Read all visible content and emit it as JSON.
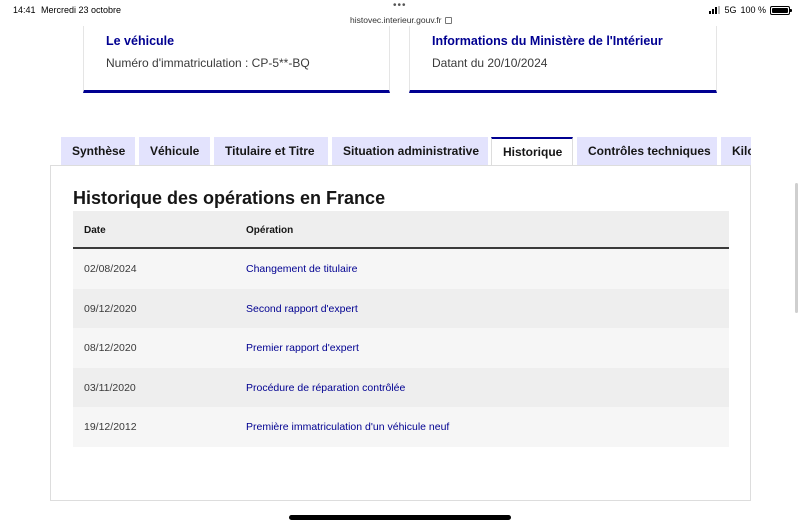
{
  "status_bar": {
    "time": "14:41",
    "date": "Mercredi 23 octobre",
    "url": "histovec.interieur.gouv.fr",
    "network": "5G",
    "battery": "100 %"
  },
  "cards": [
    {
      "title": "Le véhicule",
      "subtitle": "Numéro d'immatriculation : CP-5**-BQ"
    },
    {
      "title": "Informations du Ministère de l'Intérieur",
      "subtitle": "Datant du 20/10/2024"
    }
  ],
  "tabs": [
    {
      "label": "Synthèse"
    },
    {
      "label": "Véhicule"
    },
    {
      "label": "Titulaire et Titre"
    },
    {
      "label": "Situation administrative"
    },
    {
      "label": "Historique"
    },
    {
      "label": "Contrôles techniques"
    },
    {
      "label": "Kilométrage"
    }
  ],
  "active_tab": "Historique",
  "historique": {
    "title": "Historique des opérations en France",
    "columns": [
      "Date",
      "Opération"
    ],
    "rows": [
      {
        "date": "02/08/2024",
        "operation": "Changement de titulaire"
      },
      {
        "date": "09/12/2020",
        "operation": "Second rapport d'expert"
      },
      {
        "date": "08/12/2020",
        "operation": "Premier rapport d'expert"
      },
      {
        "date": "03/11/2020",
        "operation": "Procédure de réparation contrôlée"
      },
      {
        "date": "19/12/2012",
        "operation": "Première immatriculation d'un véhicule neuf"
      }
    ]
  },
  "colors": {
    "accent": "#000091",
    "tab_bg": "#e3e3fd"
  }
}
